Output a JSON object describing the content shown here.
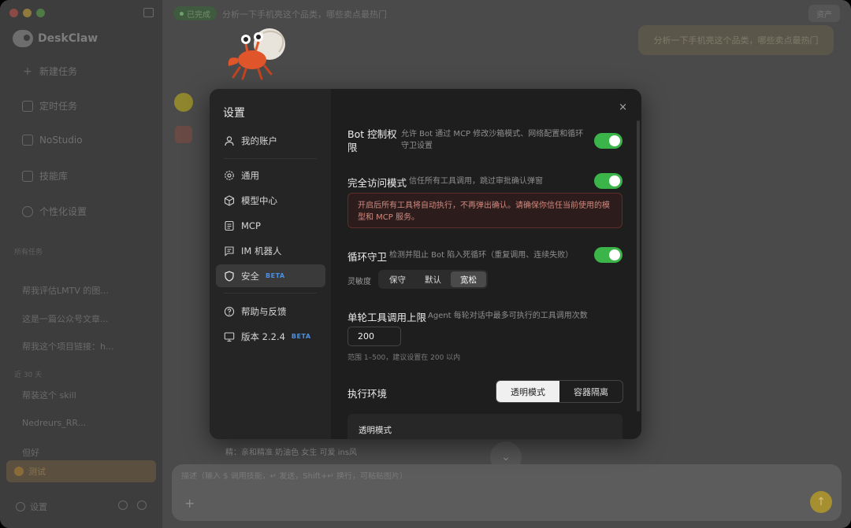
{
  "app": {
    "name": "DeskClaw"
  },
  "sidebar": {
    "items": [
      {
        "label": "新建任务",
        "icon": "plus-icon"
      },
      {
        "label": "定时任务",
        "icon": "calendar-icon"
      },
      {
        "label": "NoStudio",
        "icon": "grid-icon"
      },
      {
        "label": "技能库",
        "icon": "puzzle-icon"
      },
      {
        "label": "个性化设置",
        "icon": "sparkle-icon"
      }
    ],
    "section_earlier": "所有任务",
    "tasks": [
      "帮我评估LMTV 的图...",
      "这是一篇公众号文章...",
      "帮我这个项目链接：h..."
    ],
    "section_week": "近 30 天",
    "tasks_week": [
      "帮装这个 skill",
      "Nedreurs_RR... ",
      "但好"
    ],
    "active_task": "测试",
    "footer_label": "设置"
  },
  "topbar": {
    "status": "已完成",
    "title": "分析一下手机亮这个品类，哪些卖点最热门",
    "right_button": "资产"
  },
  "chat": {
    "user_message": "分析一下手机亮这个品类，哪些卖点最热门",
    "bg_snippet": "精：亲和精准 奶油色 女生 可爱 ins风"
  },
  "composer": {
    "placeholder": "描述（输入 $ 调用技能，↵ 发送，Shift+↵ 换行，可粘贴图片）",
    "plus": "+",
    "send": "↑"
  },
  "modal": {
    "title": "设置",
    "close": "×",
    "nav": [
      {
        "label": "我的账户",
        "icon": "user-icon"
      },
      {
        "label": "通用",
        "icon": "gear-icon"
      },
      {
        "label": "模型中心",
        "icon": "cube-icon"
      },
      {
        "label": "MCP",
        "icon": "document-icon"
      },
      {
        "label": "IM 机器人",
        "icon": "chat-icon"
      },
      {
        "label": "安全",
        "icon": "shield-icon",
        "badge": "BETA"
      },
      {
        "label": "帮助与反馈",
        "icon": "help-icon"
      },
      {
        "label": "版本 2.2.4",
        "icon": "monitor-icon",
        "badge": "BETA"
      }
    ],
    "settings": {
      "bot_control": {
        "title_line1": "Bot 控制权",
        "title_line2": "限",
        "desc": "允许 Bot 通过 MCP 修改沙箱模式、网络配置和循环守卫设置",
        "enabled": true
      },
      "full_access": {
        "title": "完全访问模式",
        "desc": "信任所有工具调用，跳过审批确认弹窗",
        "enabled": true,
        "warning": "开启后所有工具将自动执行，不再弹出确认。请确保你信任当前使用的模型和 MCP 服务。"
      },
      "loop_guard": {
        "title": "循环守卫",
        "desc": "检测并阻止 Bot 陷入死循环（重复调用、连续失败）",
        "enabled": true,
        "sensitivity_label": "灵敏度",
        "options": [
          "保守",
          "默认",
          "宽松"
        ],
        "selected": "宽松"
      },
      "tool_limit": {
        "title": "单轮工具调用上限",
        "desc": "Agent 每轮对话中最多可执行的工具调用次数",
        "value": "200",
        "hint": "范围 1–500，建议设置在 200 以内"
      },
      "exec_env": {
        "title": "执行环境",
        "options": [
          "透明模式",
          "容器隔离"
        ],
        "selected": "透明模式",
        "card_title": "透明模式"
      }
    }
  },
  "colors": {
    "toggle_on": "#3bb54a",
    "beta_badge": "#4a90e2",
    "warning_border": "#5e2e2a",
    "warning_text": "#d08a80",
    "modal_bg": "#1e1e1e"
  }
}
